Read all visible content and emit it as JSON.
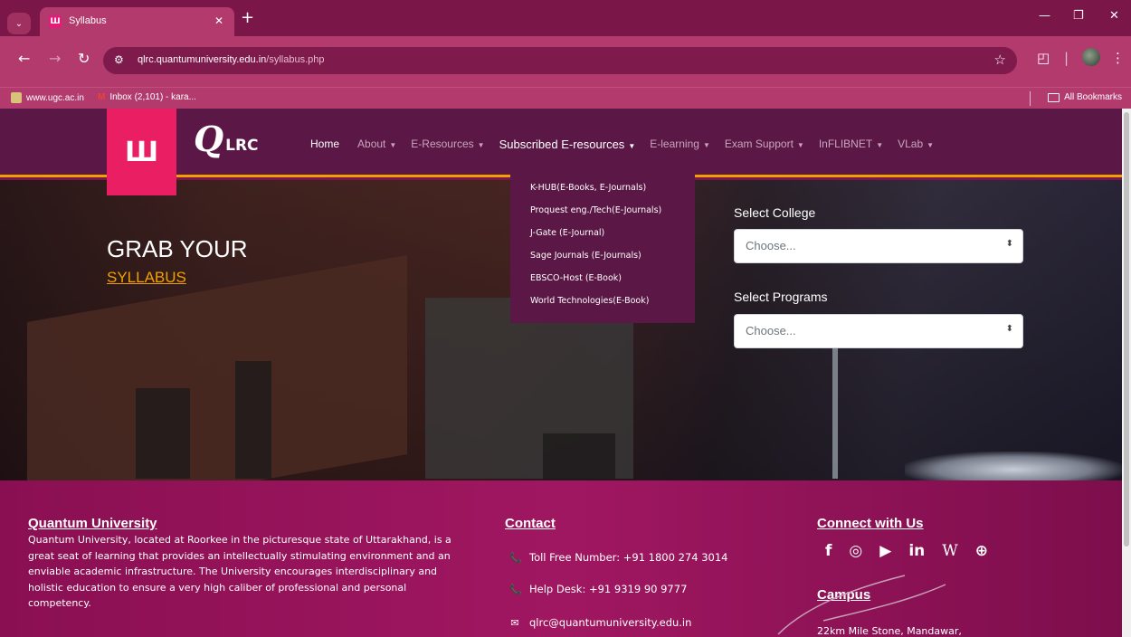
{
  "browser": {
    "tab_title": "Syllabus",
    "tab_favicon": "Ш",
    "url_host": "qlrc.quantumuniversity.edu.in",
    "url_path": "/syllabus.php",
    "bookmarks": [
      {
        "label": "www.ugc.ac.in"
      },
      {
        "label": "Inbox (2,101) - kara..."
      }
    ],
    "all_bookmarks": "All Bookmarks"
  },
  "navbar": {
    "logo_glyph": "Ш",
    "brand_q": "Q",
    "brand_lrc": "LRC",
    "menu": [
      {
        "label": "Home",
        "caret": ""
      },
      {
        "label": "About",
        "caret": "▼"
      },
      {
        "label": "E-Resources",
        "caret": "▼"
      },
      {
        "label": "Subscribed E-resources",
        "caret": "▼"
      },
      {
        "label": "E-learning",
        "caret": "▼"
      },
      {
        "label": "Exam Support",
        "caret": "▼"
      },
      {
        "label": "InFLIBNET",
        "caret": "▼"
      },
      {
        "label": "VLab",
        "caret": "▼"
      }
    ],
    "dropdown": [
      "K-HUB(E-Books, E-Journals)",
      "Proquest eng./Tech(E-Journals)",
      "J-Gate (E-Journal)",
      "Sage Journals (E-Journals)",
      "EBSCO-Host (E-Book)",
      "World Technologies(E-Book)"
    ]
  },
  "hero": {
    "heading": "GRAB YOUR",
    "link": "SYLLABUS",
    "college_label": "Select College",
    "college_value": "Choose...",
    "programs_label": "Select Programs",
    "programs_value": "Choose..."
  },
  "footer": {
    "about_title": "Quantum University",
    "about_text": "Quantum University, located at Roorkee in the picturesque state of Uttarakhand, is a great seat of learning that provides an intellectually stimulating environment and an enviable academic infrastructure. The University encourages interdisciplinary and holistic education to ensure a very high caliber of professional and personal competency.",
    "contact_title": "Contact",
    "toll_free": "Toll Free Number: +91 1800 274 3014",
    "help_desk": "Help Desk: +91 9319 90 9777",
    "email": "qlrc@quantumuniversity.edu.in",
    "connect_title": "Connect with Us",
    "socials": [
      {
        "name": "facebook-icon",
        "glyph": "f"
      },
      {
        "name": "instagram-icon",
        "glyph": "◎"
      },
      {
        "name": "youtube-icon",
        "glyph": "▶"
      },
      {
        "name": "linkedin-icon",
        "glyph": "in"
      },
      {
        "name": "wikipedia-icon",
        "glyph": "W"
      },
      {
        "name": "location-icon",
        "glyph": "⊕"
      }
    ],
    "campus_title": "Campus",
    "campus_text": "22km Mile Stone, Mandawar,"
  },
  "colors": {
    "chrome": "#7a1748",
    "toolbar": "#b23a6c",
    "navbar": "#5b1846",
    "accent": "#f0a000",
    "logo": "#e91e63"
  }
}
